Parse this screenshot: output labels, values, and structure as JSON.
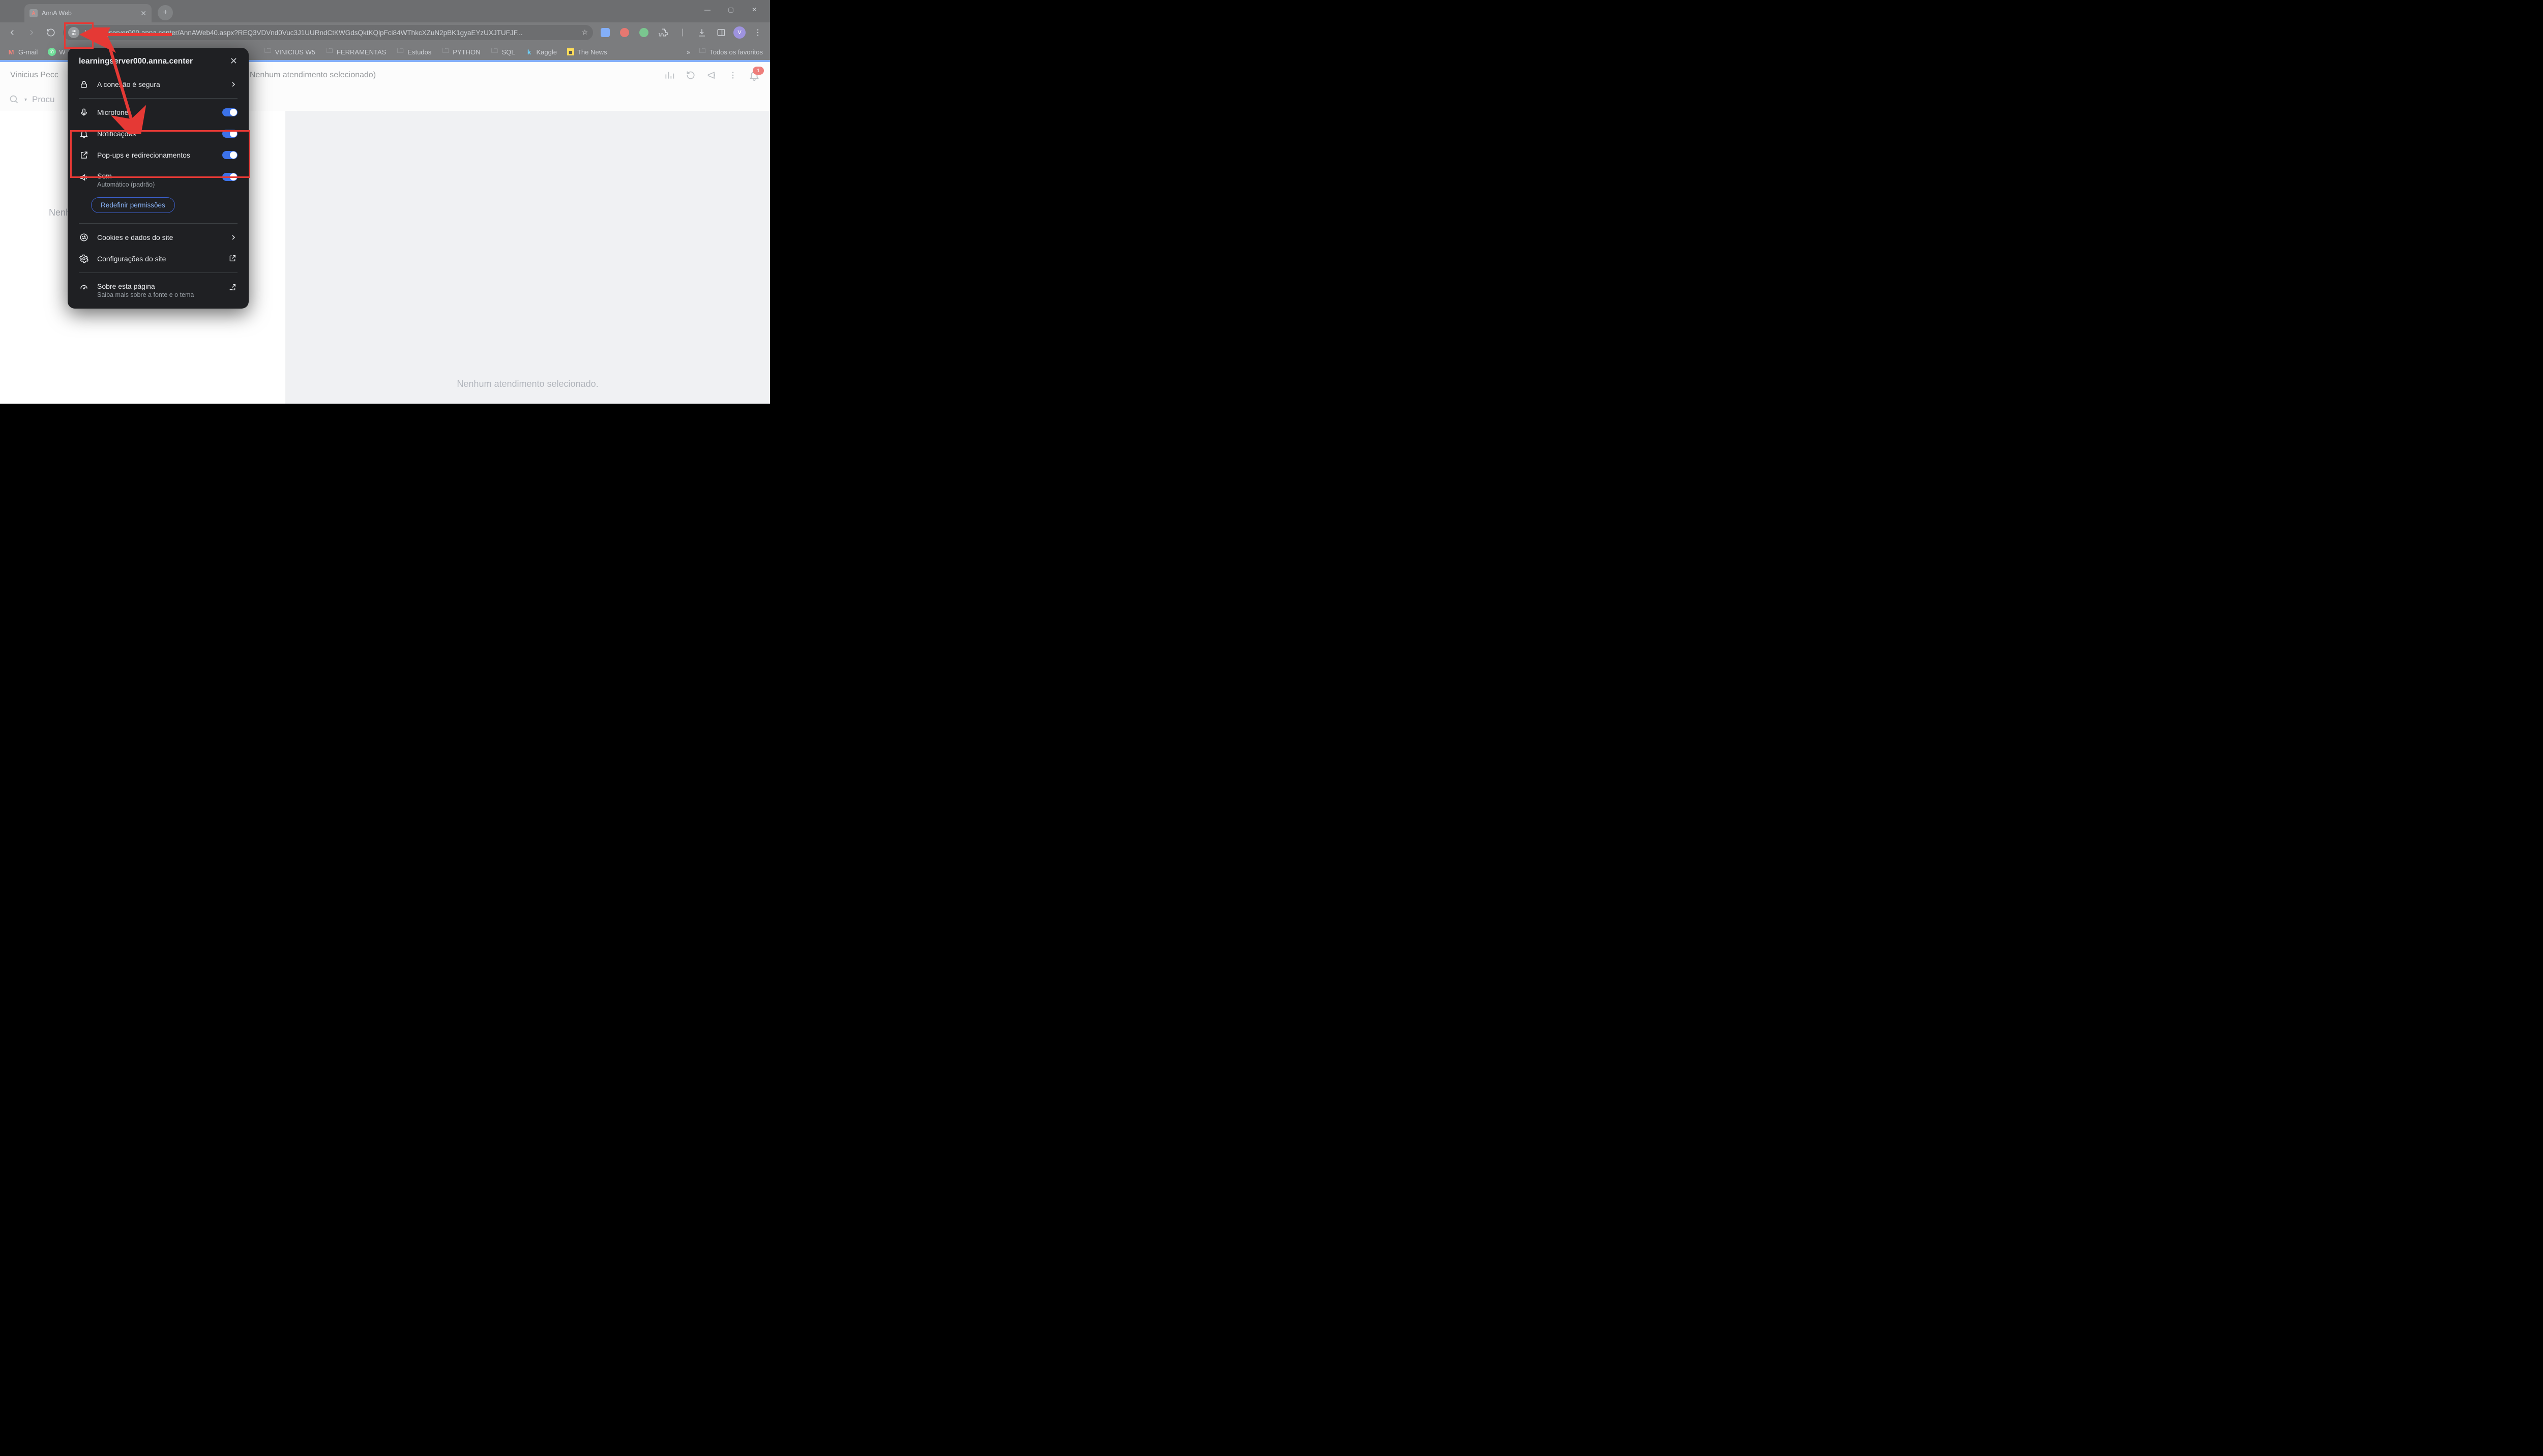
{
  "tab": {
    "title": "AnnA Web",
    "favicon_letter": "A"
  },
  "sys": {
    "min": "—",
    "max": "▢",
    "close": "✕"
  },
  "toolbar": {
    "url": "learningserver000.anna.center/AnnAWeb40.aspx?REQ3VDVnd0Vuc3J1UURndCtKWGdsQktKQlpFci84WThkcXZuN2pBK1gyaEYzUXJTUFJF...",
    "profile_letter": "V"
  },
  "bookmarks": {
    "items": [
      {
        "icon": "gmail",
        "label": "G-mail"
      },
      {
        "icon": "whatsapp",
        "label": "W"
      },
      {
        "icon": "folder",
        "label": "VINICIUS W5"
      },
      {
        "icon": "folder",
        "label": "FERRAMENTAS"
      },
      {
        "icon": "folder",
        "label": "Estudos"
      },
      {
        "icon": "folder",
        "label": "PYTHON"
      },
      {
        "icon": "folder",
        "label": "SQL"
      },
      {
        "icon": "kaggle",
        "label": "Kaggle"
      },
      {
        "icon": "news",
        "label": "The News"
      }
    ],
    "more": "»",
    "all_favs": "Todos os favoritos"
  },
  "page": {
    "user_prefix": "Vinicius Pecc",
    "header_suffix": "Nenhum atendimento selecionado)",
    "search_placeholder_visible": "Procu",
    "left_empty": "Nenh",
    "right_empty": "Nenhum atendimento selecionado.",
    "bell_badge": "1"
  },
  "popup": {
    "title": "learningserver000.anna.center",
    "rows": {
      "connection": "A conexão é segura",
      "mic": "Microfone",
      "notif": "Notificações",
      "popups": "Pop-ups e redirecionamentos",
      "sound": "Som",
      "sound_sub": "Automático (padrão)"
    },
    "reset_btn": "Redefinir permissões",
    "cookies": "Cookies e dados do site",
    "settings": "Configurações do site",
    "about": "Sobre esta página",
    "about_sub": "Saiba mais sobre a fonte e o tema"
  }
}
